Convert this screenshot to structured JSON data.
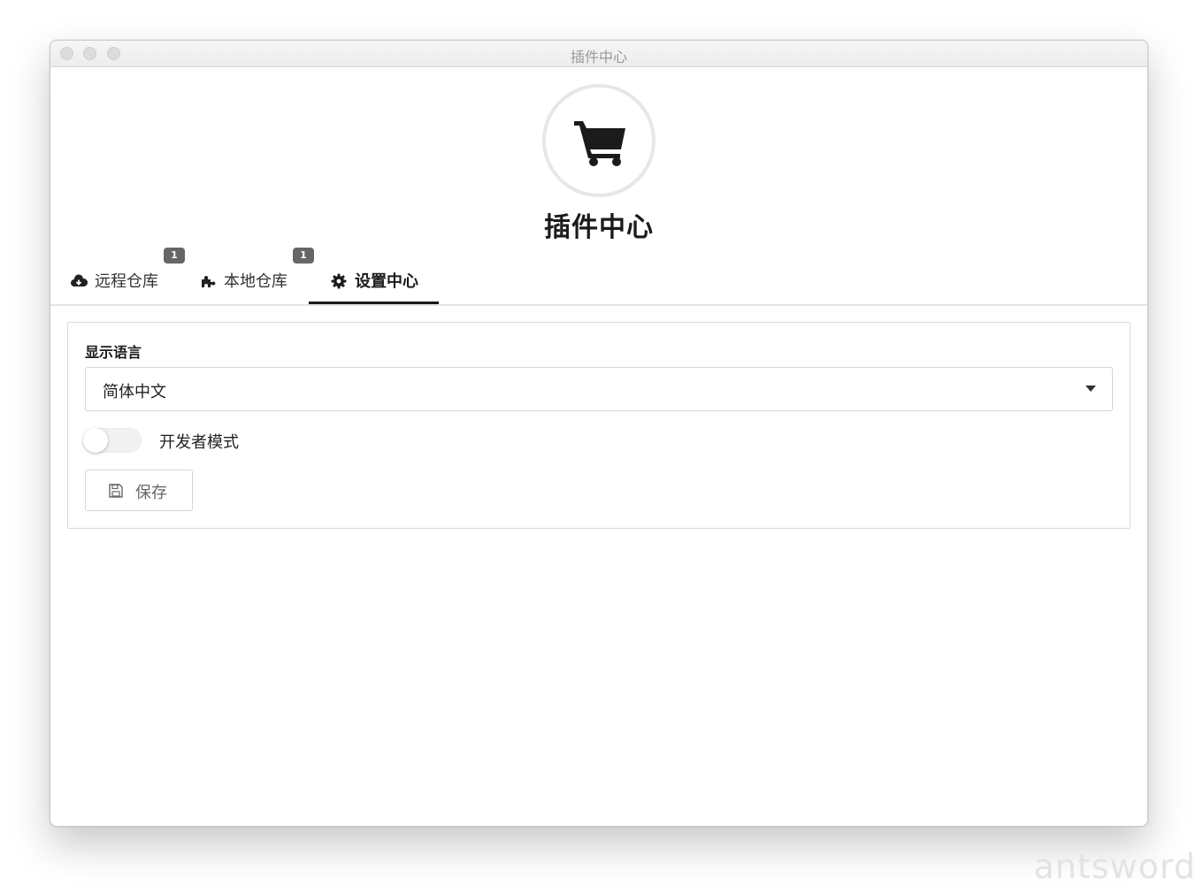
{
  "window": {
    "title": "插件中心"
  },
  "header": {
    "logo_icon": "shopping-cart-icon",
    "title": "插件中心"
  },
  "tabs": [
    {
      "label": "远程仓库",
      "icon": "cloud-download-icon",
      "badge": "1",
      "active": false
    },
    {
      "label": "本地仓库",
      "icon": "puzzle-piece-icon",
      "badge": "1",
      "active": false
    },
    {
      "label": "设置中心",
      "icon": "gear-icon",
      "active": true
    }
  ],
  "settings": {
    "language_label": "显示语言",
    "language_value": "简体中文",
    "developer_mode_label": "开发者模式",
    "developer_mode_on": false,
    "save_label": "保存",
    "save_icon": "floppy-disk-icon"
  },
  "watermark": "antsword",
  "colors": {
    "accent": "#1b1b1b",
    "badge": "#666666",
    "border": "#d9d9d9"
  }
}
